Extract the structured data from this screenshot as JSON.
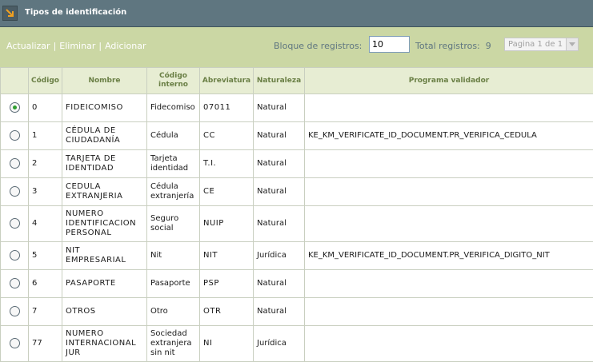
{
  "window": {
    "title": "Tipos de identificación"
  },
  "toolbar": {
    "actualizar": "Actualizar",
    "eliminar": "Eliminar",
    "adicionar": "Adicionar",
    "separator": "|",
    "bloque_label": "Bloque de registros:",
    "bloque_value": "10",
    "total_label": "Total registros:",
    "total_value": "9",
    "pager": "Pagina 1 de 1"
  },
  "table": {
    "columns": [
      "",
      "Código",
      "Nombre",
      "Código interno",
      "Abreviatura",
      "Naturaleza",
      "Programa validador"
    ],
    "selected_row": 0,
    "rows": [
      {
        "codigo": "0",
        "nombre": "FIDEICOMISO",
        "interno": "Fidecomiso",
        "abreviatura": "07011",
        "naturaleza": "Natural",
        "programa": ""
      },
      {
        "codigo": "1",
        "nombre": "CÉDULA DE CIUDADANÍA",
        "interno": "Cédula",
        "abreviatura": "CC",
        "naturaleza": "Natural",
        "programa": "KE_KM_VERIFICATE_ID_DOCUMENT.PR_VERIFICA_CEDULA"
      },
      {
        "codigo": "2",
        "nombre": "TARJETA DE IDENTIDAD",
        "interno": "Tarjeta identidad",
        "abreviatura": "T.I.",
        "naturaleza": "Natural",
        "programa": ""
      },
      {
        "codigo": "3",
        "nombre": "CEDULA EXTRANJERIA",
        "interno": "Cédula extranjería",
        "abreviatura": "CE",
        "naturaleza": "Natural",
        "programa": ""
      },
      {
        "codigo": "4",
        "nombre": "NUMERO IDENTIFICACION PERSONAL",
        "interno": "Seguro social",
        "abreviatura": "NUIP",
        "naturaleza": "Natural",
        "programa": ""
      },
      {
        "codigo": "5",
        "nombre": "NIT EMPRESARIAL",
        "interno": "Nit",
        "abreviatura": "NIT",
        "naturaleza": "Jurídica",
        "programa": "KE_KM_VERIFICATE_ID_DOCUMENT.PR_VERIFICA_DIGITO_NIT"
      },
      {
        "codigo": "6",
        "nombre": "PASAPORTE",
        "interno": "Pasaporte",
        "abreviatura": "PSP",
        "naturaleza": "Natural",
        "programa": ""
      },
      {
        "codigo": "7",
        "nombre": "OTROS",
        "interno": "Otro",
        "abreviatura": "OTR",
        "naturaleza": "Natural",
        "programa": ""
      },
      {
        "codigo": "77",
        "nombre": "NUMERO INTERNACIONAL JUR",
        "interno": "Sociedad extranjera sin nit",
        "abreviatura": "NI",
        "naturaleza": "Jurídica",
        "programa": ""
      }
    ]
  }
}
